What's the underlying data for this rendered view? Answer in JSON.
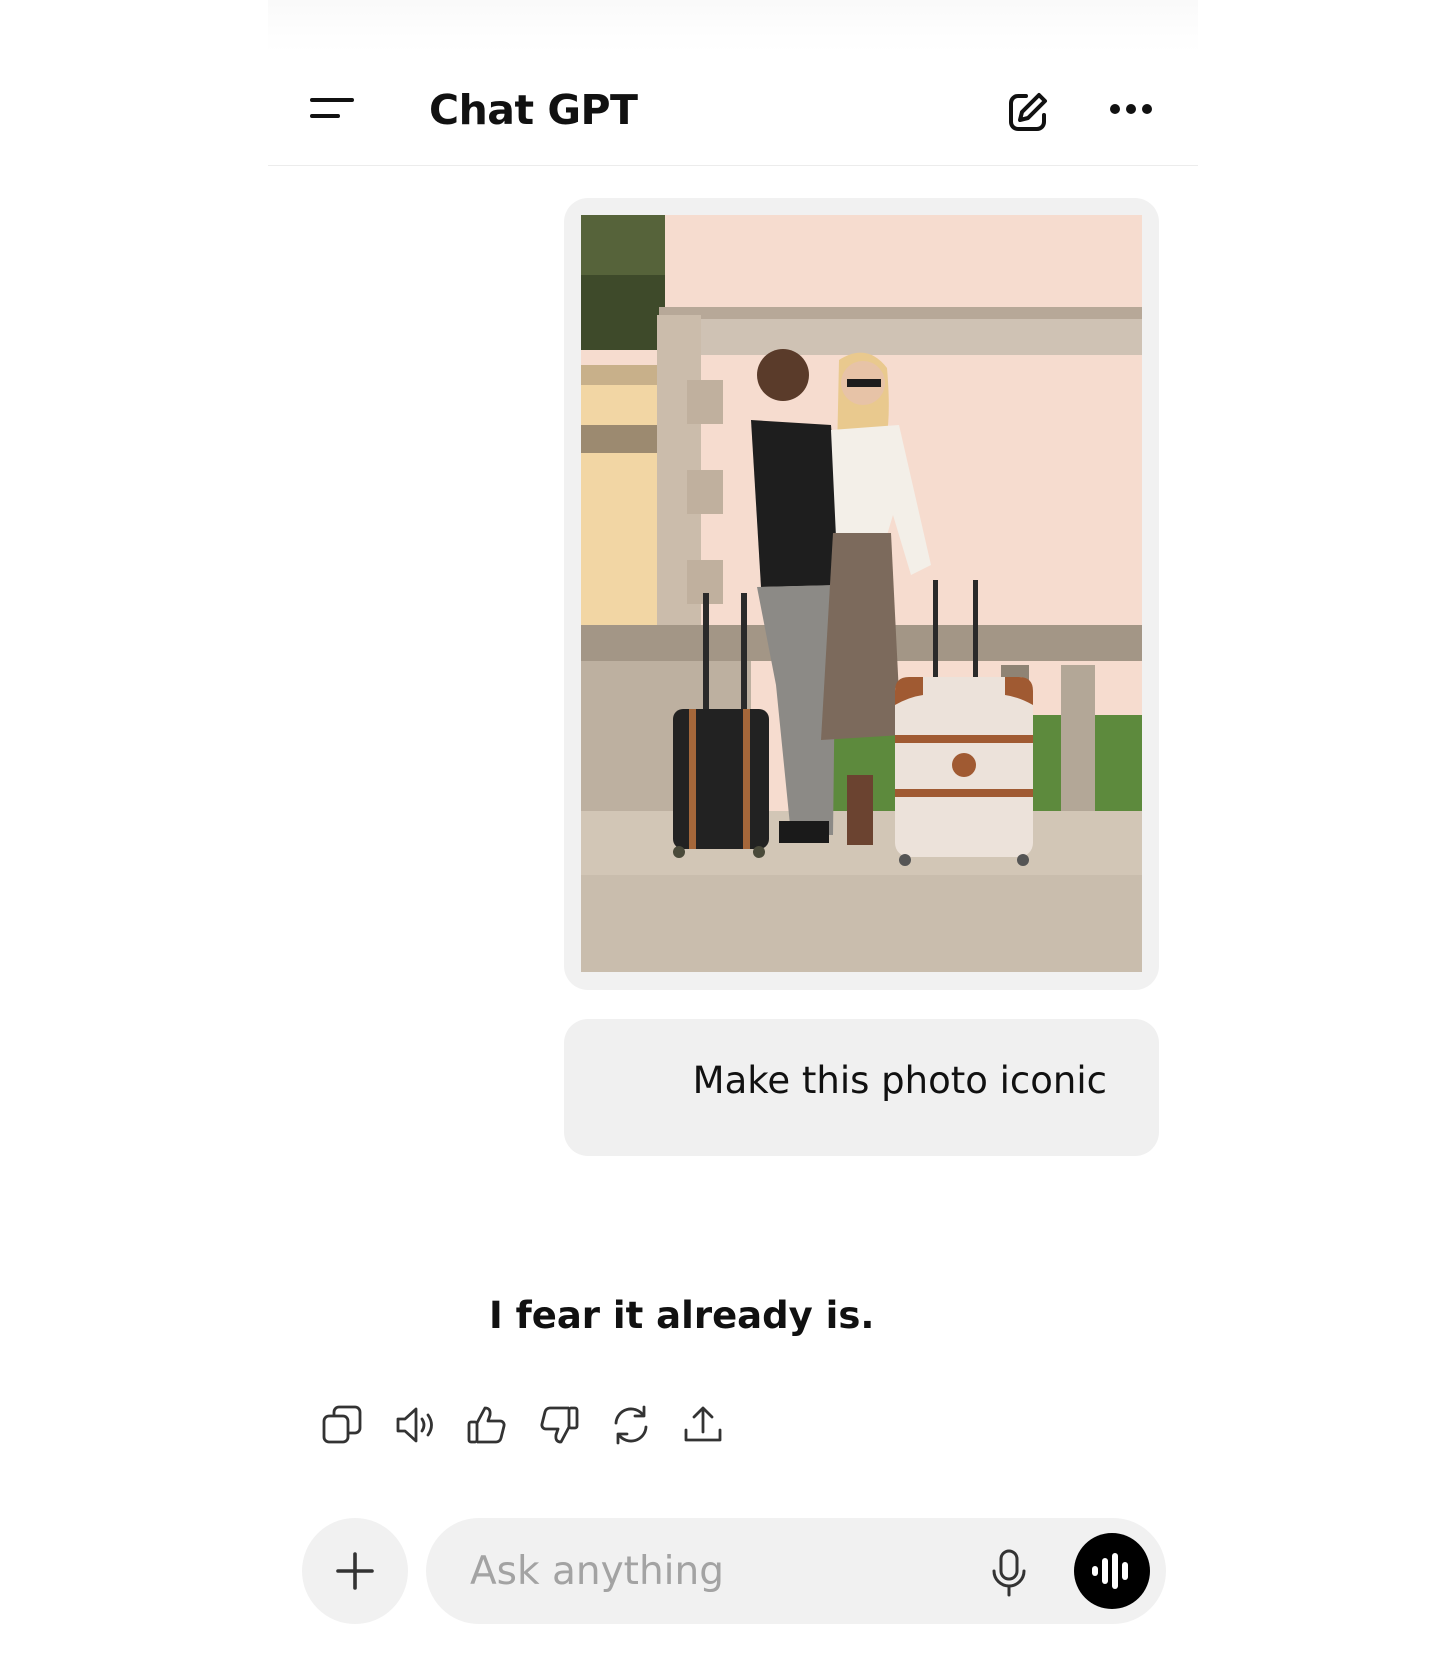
{
  "header": {
    "title": "Chat GPT",
    "icons": [
      "menu-icon",
      "edit-icon",
      "more-icon"
    ]
  },
  "conversation": {
    "user_image_alt": "Couple with suitcases in front of a pink wall",
    "user_message": "Make this photo iconic",
    "assistant_message": "I fear it already is."
  },
  "message_actions": [
    "copy-icon",
    "speaker-icon",
    "thumbs-up-icon",
    "thumbs-down-icon",
    "regenerate-icon",
    "share-icon"
  ],
  "composer": {
    "placeholder": "Ask anything",
    "value": "",
    "icons": [
      "plus-icon",
      "mic-icon",
      "voice-wave-icon"
    ]
  },
  "colors": {
    "text": "#111111",
    "bubble": "#f0f0f0",
    "placeholder": "#a3a3a3",
    "voice_button": "#000000"
  }
}
